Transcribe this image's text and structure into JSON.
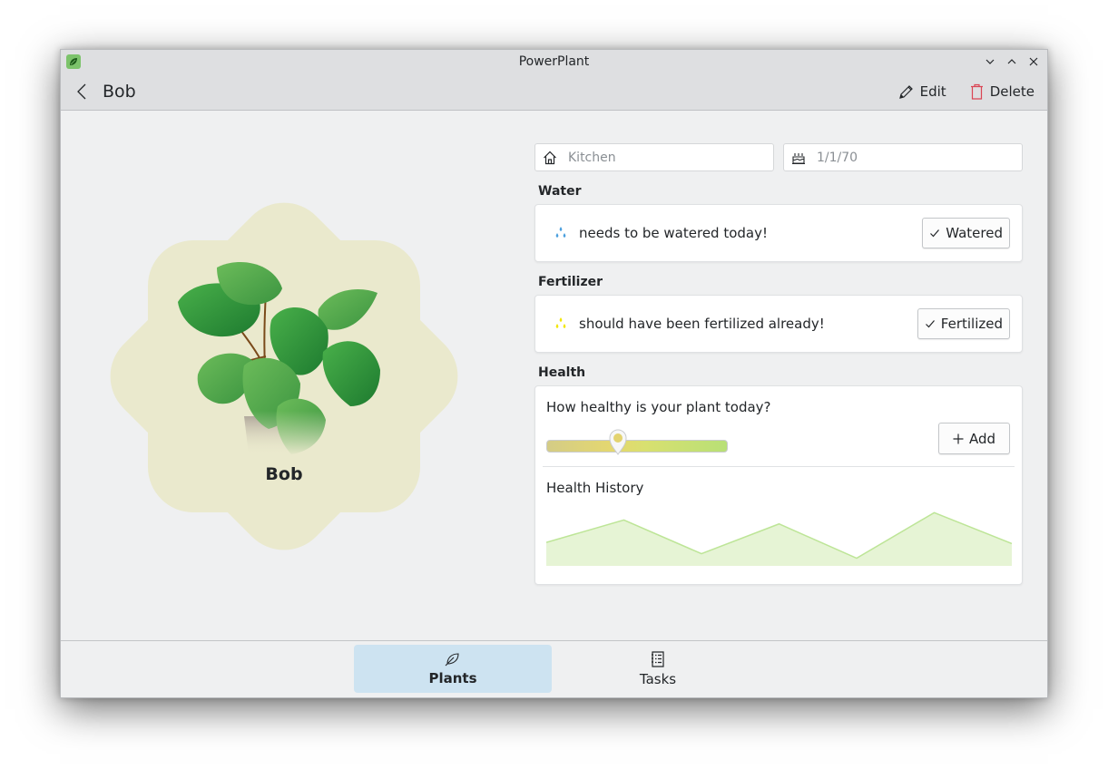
{
  "window": {
    "title": "PowerPlant",
    "app_icon": "leaf-icon",
    "controls": [
      "minimize",
      "maximize",
      "close"
    ]
  },
  "header": {
    "back_icon": "chevron-left-icon",
    "title": "Bob",
    "actions": [
      {
        "label": "Edit",
        "icon": "pencil-icon"
      },
      {
        "label": "Delete",
        "icon": "trash-icon",
        "icon_color": "#da4453"
      }
    ]
  },
  "plant": {
    "name": "Bob",
    "image": "monstera-plant-in-pot",
    "badge_color": "#eae9cd"
  },
  "details": {
    "location": {
      "icon": "home-icon",
      "value": "Kitchen"
    },
    "birthday": {
      "icon": "birthday-cake-icon",
      "value": "1/1/70"
    }
  },
  "water": {
    "section_label": "Water",
    "icon": "water-drops-icon",
    "icon_color": "#4a9fde",
    "status": "needs to be watered today!",
    "button_label": "Watered"
  },
  "fertilizer": {
    "section_label": "Fertilizer",
    "icon": "fertilizer-drops-icon",
    "icon_color": "#f2e600",
    "status": "should have been fertilized already!",
    "button_label": "Fertilized"
  },
  "health": {
    "section_label": "Health",
    "question": "How healthy is your plant today?",
    "slider_value": 0.4,
    "add_label": "Add",
    "history_label": "Health History",
    "accent": "#b7e089"
  },
  "chart_data": {
    "type": "area",
    "title": "Health History",
    "xlabel": "",
    "ylabel": "",
    "x": [
      0,
      1,
      2,
      3,
      4,
      5,
      6
    ],
    "values": [
      40,
      80,
      20,
      73,
      12,
      93,
      38
    ],
    "ylim": [
      0,
      100
    ],
    "grid": false,
    "legend": "none",
    "fill_color": "#e6f4d5",
    "line_color": "#bde597"
  },
  "bottom_nav": {
    "tabs": [
      {
        "label": "Plants",
        "icon": "leaf-icon",
        "active": true
      },
      {
        "label": "Tasks",
        "icon": "checklist-notebook-icon",
        "active": false
      }
    ]
  }
}
